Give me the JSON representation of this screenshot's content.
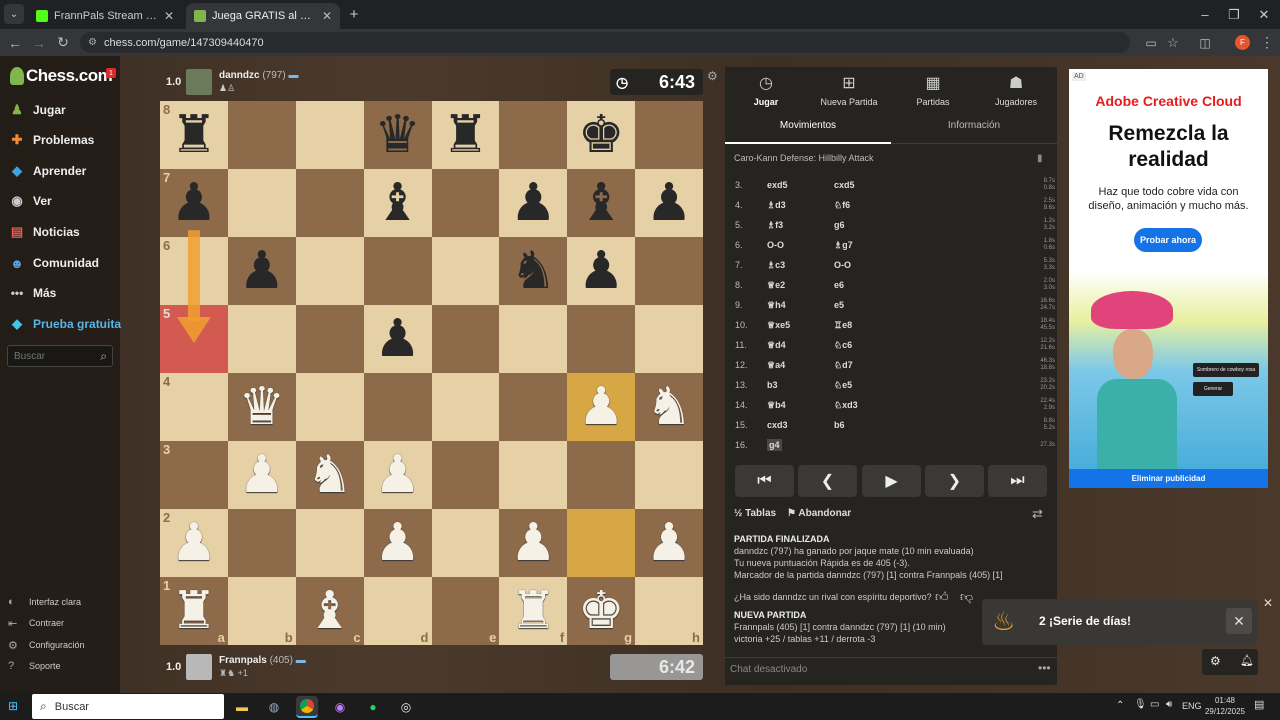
{
  "browser": {
    "tabs": [
      {
        "title": "FrannPals Stream - Watch Live o"
      },
      {
        "title": "Juega GRATIS al ajedrez online"
      }
    ],
    "new_tab": "+",
    "url": "chess.com/game/147309440470"
  },
  "sidebar": {
    "logo": "Chess.com",
    "logo_badge": "1",
    "nav": [
      {
        "label": "Jugar",
        "icon": "play-icon"
      },
      {
        "label": "Problemas",
        "icon": "puzzle-icon"
      },
      {
        "label": "Aprender",
        "icon": "learn-icon"
      },
      {
        "label": "Ver",
        "icon": "watch-icon"
      },
      {
        "label": "Noticias",
        "icon": "news-icon"
      },
      {
        "label": "Comunidad",
        "icon": "community-icon"
      },
      {
        "label": "Más",
        "icon": "more-icon"
      },
      {
        "label": "Prueba gratuita",
        "icon": "diamond-icon"
      }
    ],
    "search_placeholder": "Buscar",
    "footer": [
      {
        "label": "Interfaz clara"
      },
      {
        "label": "Contraer"
      },
      {
        "label": "Configuración"
      },
      {
        "label": "Soporte"
      }
    ]
  },
  "top_player": {
    "score": "1.0",
    "name": "danndzc",
    "rating": "(797)",
    "clock": "6:43"
  },
  "bottom_player": {
    "score": "1.0",
    "name": "Frannpals",
    "rating": "(405)",
    "extra": "+1",
    "clock": "6:42"
  },
  "board": {
    "ranks": [
      "8",
      "7",
      "6",
      "5",
      "4",
      "3",
      "2",
      "1"
    ],
    "files": [
      "a",
      "b",
      "c",
      "d",
      "e",
      "f",
      "g",
      "h"
    ],
    "highlight_squares": [
      "g4",
      "g2"
    ],
    "arrow": {
      "from": "a7",
      "to": "a5",
      "color": "#f0a030"
    },
    "pieces": {
      "a8": "bR",
      "d8": "bQ",
      "e8": "bR",
      "g8": "bK",
      "a7": "bP",
      "d7": "bB",
      "f7": "bP",
      "g7": "bB",
      "h7": "bP",
      "b6": "bP",
      "f6": "bN",
      "g6": "bP",
      "d5": "bP",
      "b4": "wQ",
      "g4": "wP",
      "h4": "wN",
      "b3": "wP",
      "c3": "wN",
      "d3": "wP",
      "a2": "wP",
      "d2": "wP",
      "f2": "wP",
      "h2": "wP",
      "a1": "wR",
      "c1": "wB",
      "f1": "wR",
      "g1": "wK"
    }
  },
  "panel": {
    "tabs": [
      {
        "label": "Jugar",
        "icon": "clock-icon"
      },
      {
        "label": "Nueva Partida",
        "icon": "plus-icon"
      },
      {
        "label": "Partidas",
        "icon": "grid-icon"
      },
      {
        "label": "Jugadores",
        "icon": "players-icon"
      }
    ],
    "subtabs": [
      "Movimientos",
      "Información"
    ],
    "opening": "Caro-Kann Defense: Hillbilly Attack",
    "moves": [
      {
        "n": "3.",
        "w": "exd5",
        "b": "cxd5",
        "wt": "8.7s",
        "bt": "0.8s"
      },
      {
        "n": "4.",
        "w": "♗d3",
        "b": "♘f6",
        "wt": "2.5s",
        "bt": "9.6s"
      },
      {
        "n": "5.",
        "w": "♗f3",
        "b": "g6",
        "wt": "1.2s",
        "bt": "3.2s"
      },
      {
        "n": "6.",
        "w": "O-O",
        "b": "♗g7",
        "wt": "1.8s",
        "bt": "0.6s"
      },
      {
        "n": "7.",
        "w": "♗c3",
        "b": "O-O",
        "wt": "5.3s",
        "bt": "3.3s"
      },
      {
        "n": "8.",
        "w": "♕e2",
        "b": "e6",
        "wt": "2.0s",
        "bt": "3.0s"
      },
      {
        "n": "9.",
        "w": "♕h4",
        "b": "e5",
        "wt": "16.6s",
        "bt": "24.7s"
      },
      {
        "n": "10.",
        "w": "♕xe5",
        "b": "♖e8",
        "wt": "18.4s",
        "bt": "45.5s"
      },
      {
        "n": "11.",
        "w": "♕d4",
        "b": "♘c6",
        "wt": "12.2s",
        "bt": "21.6s"
      },
      {
        "n": "12.",
        "w": "♕a4",
        "b": "♘d7",
        "wt": "46.3s",
        "bt": "18.8s"
      },
      {
        "n": "13.",
        "w": "b3",
        "b": "♘e5",
        "wt": "23.2s",
        "bt": "20.2s"
      },
      {
        "n": "14.",
        "w": "♕b4",
        "b": "♘xd3",
        "wt": "22.4s",
        "bt": "2.9s"
      },
      {
        "n": "15.",
        "w": "cxd3",
        "b": "b6",
        "wt": "8.8s",
        "bt": "5.2s"
      },
      {
        "n": "16.",
        "w": "g4",
        "b": "",
        "wt": "27.3s",
        "bt": ""
      }
    ],
    "actions": {
      "draw": "Tablas",
      "resign": "Abandonar"
    },
    "game_over": {
      "title": "PARTIDA FINALIZADA",
      "line1": "danndzc (797) ha ganado por jaque mate (10 min evaluada)",
      "line2": "Tu nueva puntuación Rápida es de 405 (-3).",
      "line3": "Marcador de la partida danndzc (797) [1] contra Frannpals (405) [1]",
      "question": "¿Ha sido danndzc un rival con espíritu deportivo?"
    },
    "new_game": {
      "title": "NUEVA PARTIDA",
      "line1": "Frannpals (405) [1] contra danndzc (797) [1] (10 min)",
      "line2": "victoria +25 / tablas +11 / derrota -3"
    },
    "chat": "Chat desactivado"
  },
  "ad": {
    "badge": "AD",
    "brand": "Adobe Creative Cloud",
    "headline": "Remezcla la realidad",
    "body": "Haz que todo cobre vida con diseño, animación y mucho más.",
    "cta": "Probar ahora",
    "prompt_label": "Sombrero de cowboy rosa",
    "generate": "Generar",
    "remove": "Eliminar publicidad"
  },
  "toast": {
    "text": "2 ¡Serie de días!"
  },
  "taskbar": {
    "search": "Buscar",
    "lang": "ENG",
    "time": "01:48",
    "date": "29/12/2025"
  },
  "colors": {
    "accent_green": "#81b64c",
    "highlight": "#d7a746",
    "red_square": "#d25a50"
  }
}
